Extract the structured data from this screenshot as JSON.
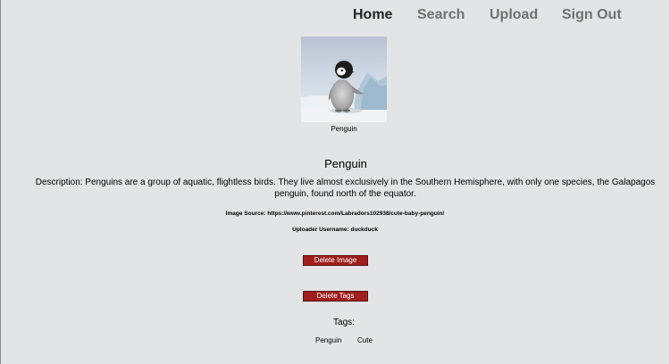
{
  "nav": {
    "home": "Home",
    "search": "Search",
    "upload": "Upload",
    "sign_out": "Sign Out"
  },
  "image": {
    "caption": "Penguin",
    "alt": "Penguin chick standing in the snow"
  },
  "detail": {
    "title": "Penguin",
    "description": "Description: Penguins are a group of aquatic, flightless birds. They live almost exclusively in the Southern Hemisphere, with only one species, the Galapagos penguin, found north of the equator.",
    "image_source": "Image Source: https://www.pinterest.com/Labradors102938/cute-baby-penguin/",
    "uploader": "Uploader Username: duckduck"
  },
  "actions": {
    "delete_image": "Delete Image",
    "delete_tags": "Delete Tags"
  },
  "tags": {
    "heading": "Tags:",
    "items": [
      "Penguin",
      "Cute"
    ]
  },
  "colors": {
    "background": "#e3e4e6",
    "nav_active": "#222222",
    "nav_inactive": "#707070",
    "danger_button": "#a01e1e"
  }
}
